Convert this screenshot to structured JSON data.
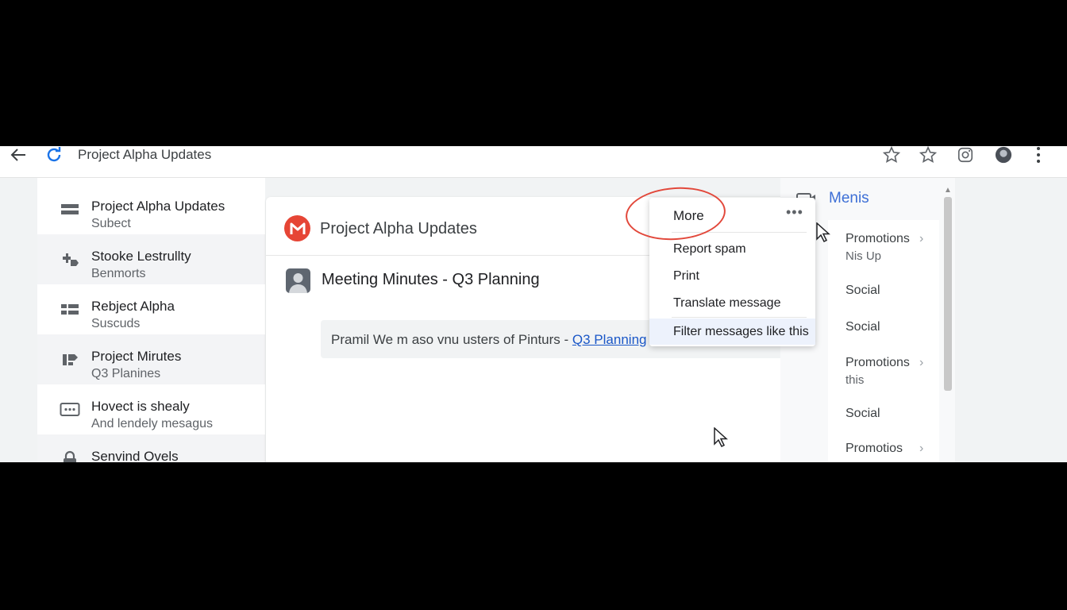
{
  "browser": {
    "tab_title": "Project Alpha Updates"
  },
  "icons": {
    "back": "back-arrow-icon",
    "reload": "reload-icon",
    "star": "star-icon",
    "instagram": "instagram-icon",
    "profile": "profile-icon",
    "more": "kebab-menu-icon"
  },
  "colors": {
    "accent": "#3d6fd6",
    "mail_logo": "#e64535",
    "link": "#1a57c7",
    "annotation": "#e2483b"
  },
  "left_list": [
    {
      "title": "Project Alpha Updates",
      "subtitle": "Subect"
    },
    {
      "title": "Stooke Lestrullty",
      "subtitle": "Benmorts"
    },
    {
      "title": "Rebject Alpha",
      "subtitle": "Suscuds"
    },
    {
      "title": "Project Mirutes",
      "subtitle": "Q3 Planines"
    },
    {
      "title": "Hovect is shealy",
      "subtitle": "And lendely mesagus"
    },
    {
      "title": "Senvind Ovels",
      "subtitle": ""
    }
  ],
  "main": {
    "title": "Project Alpha Updates",
    "subject": "Meeting Minutes - Q3 Planning",
    "snippet_text": "Pramil We m aso vnu usters of Pinturs - ",
    "snippet_link": "Q3 Planning"
  },
  "menu": {
    "header": "More",
    "dots": "•••",
    "items": [
      "Report spam",
      "Print",
      "Translate message",
      "Filter messages like this"
    ]
  },
  "right_panel": {
    "title": "Menis",
    "items": [
      {
        "label": "Promotions",
        "sub": "Nis Up",
        "chevron": "›"
      },
      {
        "label": "Social",
        "sub": "",
        "chevron": ""
      },
      {
        "label": "Social",
        "sub": "",
        "chevron": ""
      },
      {
        "label": "Promotions",
        "sub": "this",
        "chevron": "›"
      },
      {
        "label": "Social",
        "sub": "",
        "chevron": ""
      },
      {
        "label": "Promotios",
        "sub": "",
        "chevron": "›"
      }
    ]
  }
}
